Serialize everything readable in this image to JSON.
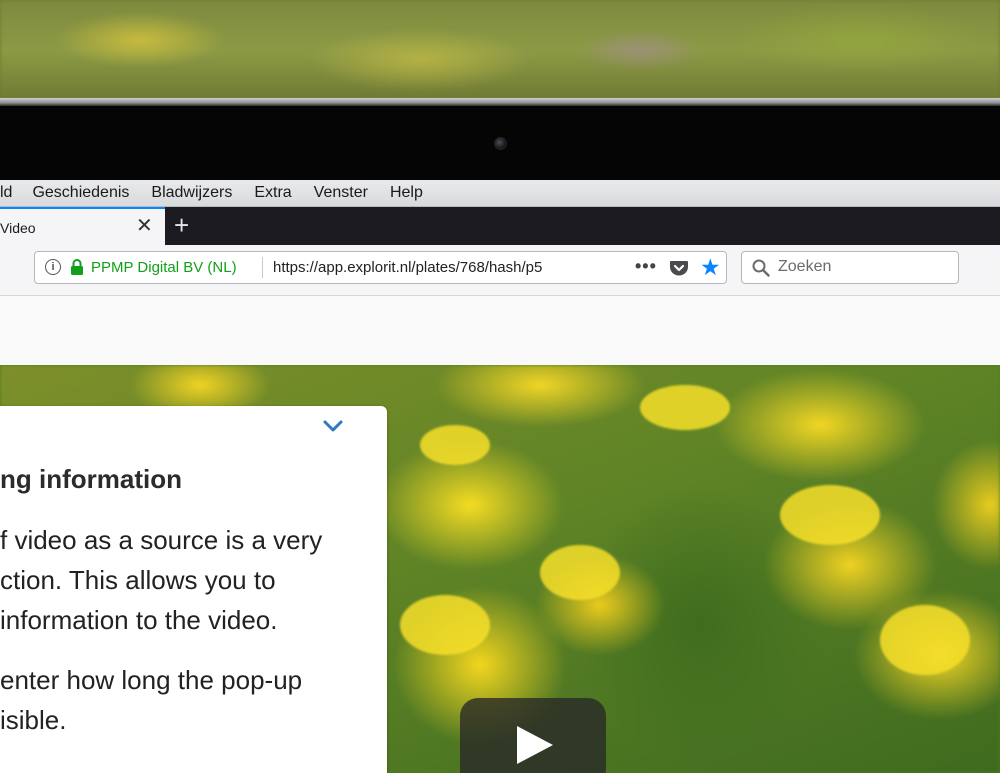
{
  "menubar": {
    "items": [
      "ld",
      "Geschiedenis",
      "Bladwijzers",
      "Extra",
      "Venster",
      "Help"
    ]
  },
  "tabs": {
    "active_title": "Video",
    "close_symbol": "✕",
    "new_tab_symbol": "+"
  },
  "navbar": {
    "site_identity": "PPMP Digital BV (NL)",
    "url": "https://app.explorit.nl/plates/768/hash/p5",
    "more_symbol": "•••",
    "bookmark_symbol": "★",
    "search_placeholder": "Zoeken"
  },
  "popup": {
    "heading": "ng information",
    "paragraph1": [
      "f video as a source is a very",
      "ction. This allows you to",
      " information to the video."
    ],
    "paragraph2": [
      "enter how long the pop-up",
      "isible."
    ]
  },
  "colors": {
    "accent_blue": "#0a84ff",
    "secure_green": "#12a01a",
    "tabstrip_dark": "#1c1b22"
  },
  "icons": [
    "info-icon",
    "lock-icon",
    "pocket-icon",
    "star-icon",
    "search-icon",
    "chevron-down-icon",
    "play-icon",
    "close-icon",
    "plus-icon"
  ]
}
